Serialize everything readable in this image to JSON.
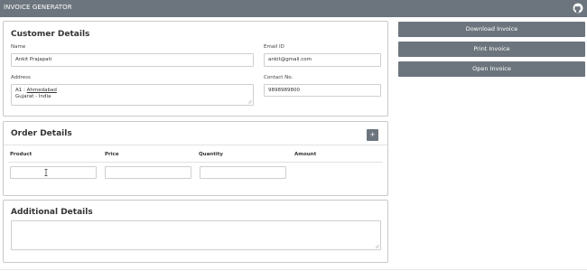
{
  "app": {
    "title": "INVOICE GENERATOR",
    "github_icon": "github-icon"
  },
  "actions": {
    "download_label": "Download Invoice",
    "print_label": "Print Invoice",
    "open_label": "Open Invoice"
  },
  "customer": {
    "title": "Customer Details",
    "name_label": "Name",
    "name_value": "Ankit Prajapati",
    "email_label": "Email ID",
    "email_value": "ankit@gmail.com",
    "address_label": "Address",
    "address_line1_prefix": "A1 : ",
    "address_line1_city": "Ahmedabad",
    "address_line2": "Gujarat - India",
    "contact_label": "Contact No.",
    "contact_value": "9898989800"
  },
  "order": {
    "title": "Order Details",
    "add_label": "+",
    "columns": [
      "Product",
      "Price",
      "Quantity",
      "Amount"
    ]
  },
  "additional": {
    "title": "Additional Details"
  }
}
